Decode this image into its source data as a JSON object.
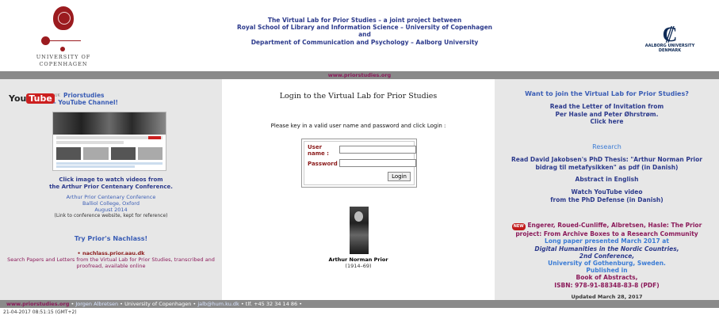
{
  "header": {
    "ku_text_line1": "UNIVERSITY OF",
    "ku_text_line2": "COPENHAGEN",
    "title_lines": [
      "The Virtual Lab for Prior Studies – a joint project between",
      "Royal School of Library and Information Science – University of Copenhagen",
      "and",
      "Department of Communication and Psychology – Aalborg University"
    ],
    "aau_text_line1": "AALBORG UNIVERSITY",
    "aau_text_line2": "DENMARK"
  },
  "topbar": {
    "site_link": "www.priorstudies.org"
  },
  "left": {
    "yt_you": "You",
    "yt_tube": "Tube",
    "yt_tm": "UK",
    "yt_title_l1": "Priorstudies",
    "yt_title_l2": "– YouTube Channel!",
    "thumb_caption": [
      "Click image to watch videos from",
      "the Arthur Prior Centenary Conference."
    ],
    "conf_lines": [
      "Arthur Prior Centenary Conference",
      "Balliol College, Oxford",
      "August 2014"
    ],
    "conf_note": "(Link to conference website, kept for reference)",
    "nachlass_head": "Try Prior's Nachlass!",
    "nachlass_link": "• nachlass.prior.aau.dk",
    "nachlass_desc_l1": "Search Papers and Letters from the Virtual Lab for Prior Studies, transcribed and",
    "nachlass_desc_l2": "proofread, available online"
  },
  "middle": {
    "login_title": "Login to the Virtual Lab for Prior Studies",
    "intro": "Please key in a valid user name and password and click Login :",
    "user_label_l1": "User",
    "user_label_l2": "name :",
    "password_label": "Password :",
    "user_value": "",
    "password_value": "",
    "login_button": "Login",
    "prior_name": "Arthur Norman Prior",
    "prior_years": "(1914–69)"
  },
  "right": {
    "join_head": "Want to join the Virtual Lab for Prior Studies?",
    "letter_lines": [
      "Read the Letter of Invitation from",
      "Per Hasle and Peter Øhrstrøm.",
      "Click here"
    ],
    "research_head": "Research",
    "thesis_lines": [
      "Read David Jakobsen's PhD Thesis: \"Arthur Norman Prior",
      "bidrag til metafysikken\" as pdf (in Danish)"
    ],
    "abstract": "Abstract in English",
    "video_lines": [
      "Watch YouTube video",
      "from the PhD Defense (in Danish)"
    ],
    "new_badge": "NEW",
    "paper_l1": "Engerer, Roued-Cunliffe, Albretsen, Hasle: The Prior",
    "paper_l2": "project: From Archive Boxes to a Research Community",
    "paper_l3": "Long paper presented March 2017 at",
    "paper_l4": "Digital Humanities in the Nordic Countries,",
    "paper_l5": "2nd Conference,",
    "paper_l6": "University of Gothenburg, Sweden.",
    "paper_l7": "Published in",
    "paper_l8": "Book of Abstracts,",
    "paper_l9": "ISBN: 978-91-88348-83-8 (PDF)",
    "updated": "Updated March 28, 2017"
  },
  "footer": {
    "site": "www.priorstudies.org",
    "sep1": " • ",
    "name": "Jorgen Albretsen",
    "sep2": " • ",
    "uni": "University of Copenhagen",
    "sep3": " • ",
    "email": "jalb@hum.ku.dk",
    "sep4": " • ",
    "phone": "tlf. +45 32 34 14 86",
    "sep5": " •"
  },
  "timestamp": "21-04-2017 08:51:15 (GMT+2)",
  "colors": {
    "accent_blue": "#2c3a8c",
    "magenta": "#8b1a5a",
    "bar_gray": "#8a8a8a",
    "panel_gray": "#e7e7e7"
  }
}
